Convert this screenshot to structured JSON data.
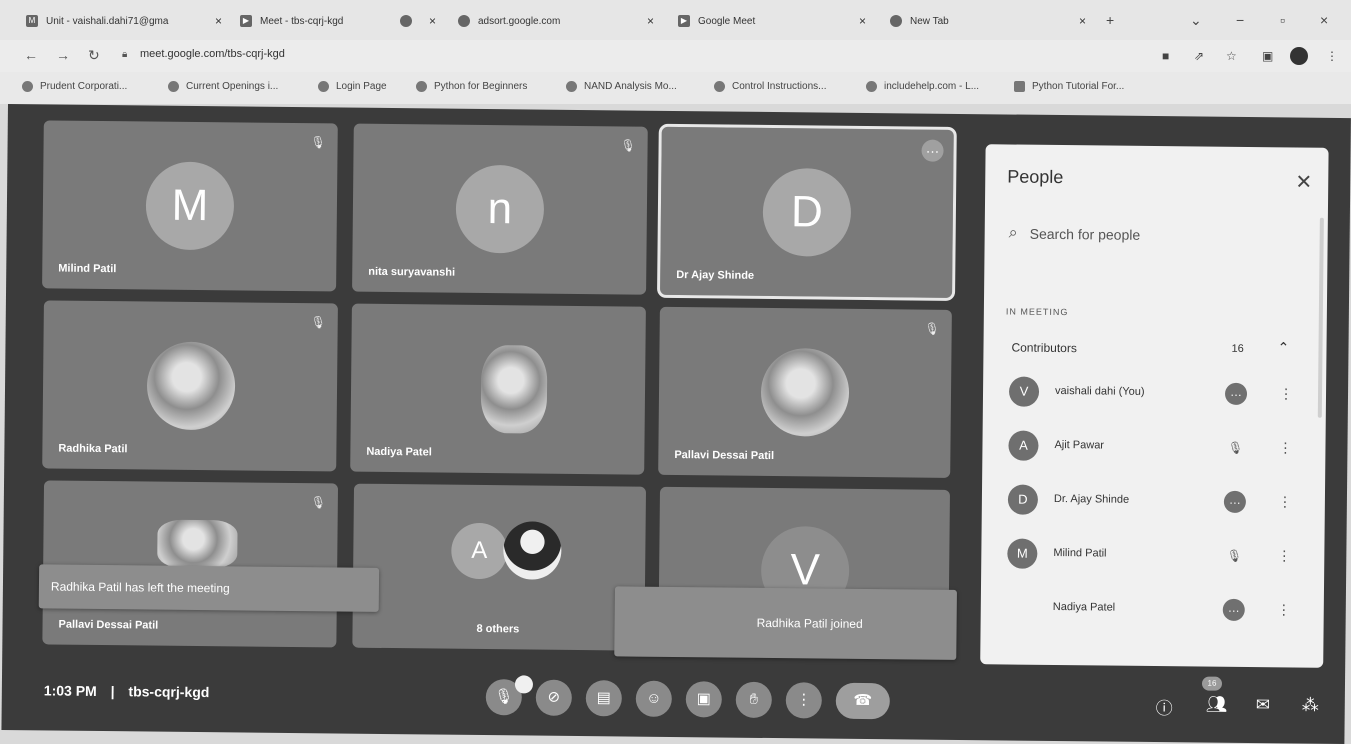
{
  "browser": {
    "tabs": [
      {
        "label": "Unit - vaishali.dahi71@gma",
        "icon": "gmail-icon"
      },
      {
        "label": "Meet - tbs-cqrj-kgd",
        "icon": "meet-icon"
      },
      {
        "label": "",
        "icon": "tab-icon"
      },
      {
        "label": "adsort.google.com",
        "icon": "globe-icon"
      },
      {
        "label": "Google Meet",
        "icon": "meet-icon"
      },
      {
        "label": "New Tab",
        "icon": "chrome-icon"
      }
    ],
    "url": "meet.google.com/tbs-cqrj-kgd",
    "bookmarks": [
      "Prudent Corporati...",
      "Current Openings i...",
      "Login Page",
      "Python for Beginners",
      "NAND Analysis Mo...",
      "Control Instructions...",
      "includehelp.com - L...",
      "Python Tutorial For..."
    ]
  },
  "tiles": [
    {
      "initial": "M",
      "name": "Milind Patil",
      "type": "letter",
      "status": "mic-off"
    },
    {
      "initial": "n",
      "name": "nita suryavanshi",
      "type": "letter",
      "status": "mic-off"
    },
    {
      "initial": "D",
      "name": "Dr Ajay Shinde",
      "type": "letter",
      "status": "more"
    },
    {
      "initial": "",
      "name": "Radhika Patil",
      "type": "photo",
      "status": "mic-off"
    },
    {
      "initial": "",
      "name": "Nadiya Patel",
      "type": "photo",
      "status": "none"
    },
    {
      "initial": "",
      "name": "Pallavi Dessai Patil",
      "type": "photo",
      "status": "mic-off"
    },
    {
      "initial": "",
      "name": "Pallavi Dessai Patil",
      "type": "photo",
      "status": "mic-off"
    },
    {
      "initial": "A",
      "name": "8 others",
      "type": "group",
      "status": "none"
    },
    {
      "initial": "V",
      "name": "",
      "type": "letter",
      "status": "none"
    }
  ],
  "toasts": {
    "left_message": "Radhika Patil has left the meeting",
    "joined_message": "Radhika Patil joined"
  },
  "people_panel": {
    "title": "People",
    "search_placeholder": "Search for people",
    "section_label": "IN MEETING",
    "group_label": "Contributors",
    "group_count": "16",
    "people": [
      {
        "initial": "V",
        "name": "vaishali dahi (You)",
        "status": "speaking"
      },
      {
        "initial": "A",
        "name": "Ajit Pawar",
        "status": "mic-off"
      },
      {
        "initial": "D",
        "name": "Dr. Ajay Shinde",
        "status": "speaking"
      },
      {
        "initial": "M",
        "name": "Milind Patil",
        "status": "mic-off"
      },
      {
        "initial": "",
        "name": "Nadiya Patel",
        "status": "speaking"
      }
    ]
  },
  "bottom_bar": {
    "time": "1:03 PM",
    "separator": "|",
    "meeting_code": "tbs-cqrj-kgd",
    "people_badge": "16"
  }
}
